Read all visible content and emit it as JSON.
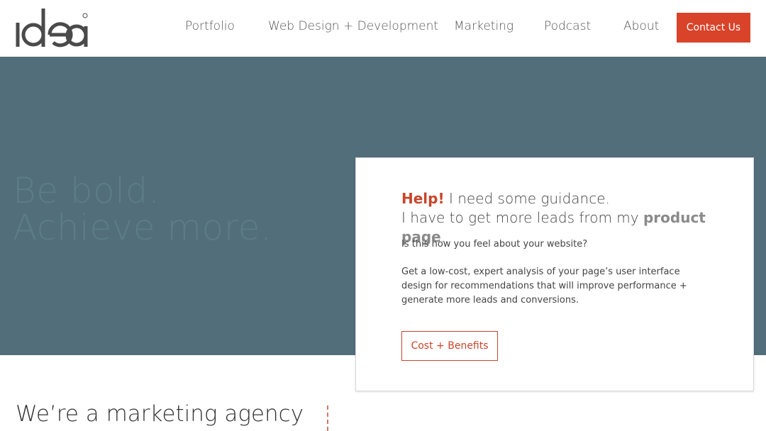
{
  "header": {
    "logo_text": "idea",
    "nav": [
      "Portfolio",
      "Web Design + Development",
      "Marketing",
      "Podcast",
      "About"
    ],
    "contact_label": "Contact Us"
  },
  "hero": {
    "line1": "Be bold.",
    "line2": "Achieve more."
  },
  "card": {
    "help": "Help!",
    "line1_rest": " I need some guidance.",
    "line2_start": "I have to get more leads from my ",
    "line2_bold": "product page",
    "line2_end": ".",
    "question": "Is this how you feel about your website?",
    "description": "Get a low-cost, expert analysis of your page’s user interface design for recommendations that will improve performance + generate more leads and conversions.",
    "button_label": "Cost + Benefits"
  },
  "section": {
    "heading": "We’re a marketing agency"
  },
  "colors": {
    "accent": "#d8432a",
    "hero_bg": "#516e7a",
    "hero_text": "#5d7c88"
  }
}
